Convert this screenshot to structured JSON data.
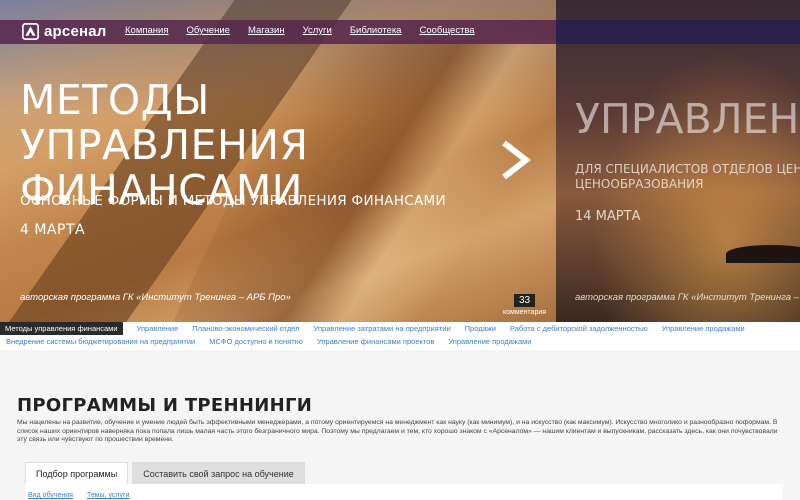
{
  "brand": {
    "name": "арсенал"
  },
  "nav": [
    "Компания",
    "Обучение",
    "Магазин",
    "Услуги",
    "Библиотека",
    "Сообщества"
  ],
  "slides": {
    "current": {
      "title": "МЕТОДЫ УПРАВЛЕНИЯ ФИНАНСАМИ",
      "subtitle": "ОСНОВНЫЕ ФОРМЫ И МЕТОДЫ УПРАВЛЕНИЯ ФИНАНСАМИ",
      "date": "4 МАРТА",
      "author": "авторская программа ГК «Институт Тренинга – АРБ Про»",
      "comments_count": "33",
      "comments_label": "комментария"
    },
    "next": {
      "title": "УПРАВЛЕНИ",
      "subtitle_line1": "ДЛЯ СПЕЦИАЛИСТОВ ОТДЕЛОВ ЦЕН",
      "subtitle_line2": "ЦЕНООБРАЗОВАНИЯ",
      "date": "14 МАРТА",
      "author": "авторская программа ГК «Институт Тренинга – АРБ"
    }
  },
  "tags": {
    "row1": [
      "Методы управления финансами",
      "Управление",
      "Планово-экономический отдел",
      "Управление затратами на предприятии",
      "Продажи",
      "Работа с дебиторской задолженностью",
      "Управление продажами"
    ],
    "row2": [
      "Внедрение системы бюджетирования на предприятии",
      "МСФО доступно и понятно",
      "Управление финансами проектов",
      "Управление продажами"
    ]
  },
  "section": {
    "title": "ПРОГРАММЫ И ТРЕННИНГИ",
    "description": "Мы нацелены на развитие, обучение и умение людей быть эффективными менеджерами, а потому ориентируемся на менеджмент как науку (как минимум), и на искусство (как максимум). Искусство многолико и разнообразно поформам. В список наших ориентиров наверняка пока попала лишь малая часть этого безграничного мира. Поэтому мы предлагаем и тем, кто хорошо знаком с «Арсеналом» — нашим клиентам и выпускникам, рассказать здесь, как они почувствовали эту связь или чувствуют по прошествии времени."
  },
  "tabs": [
    "Подбор программы",
    "Составить свой запрос на обучение"
  ],
  "panel_links": [
    "Вид обучения",
    "Темы, услуги"
  ],
  "colors": {
    "topbar": "#58284e",
    "link": "#3f7fc4",
    "active_tag_bg": "#2a2a2a"
  }
}
